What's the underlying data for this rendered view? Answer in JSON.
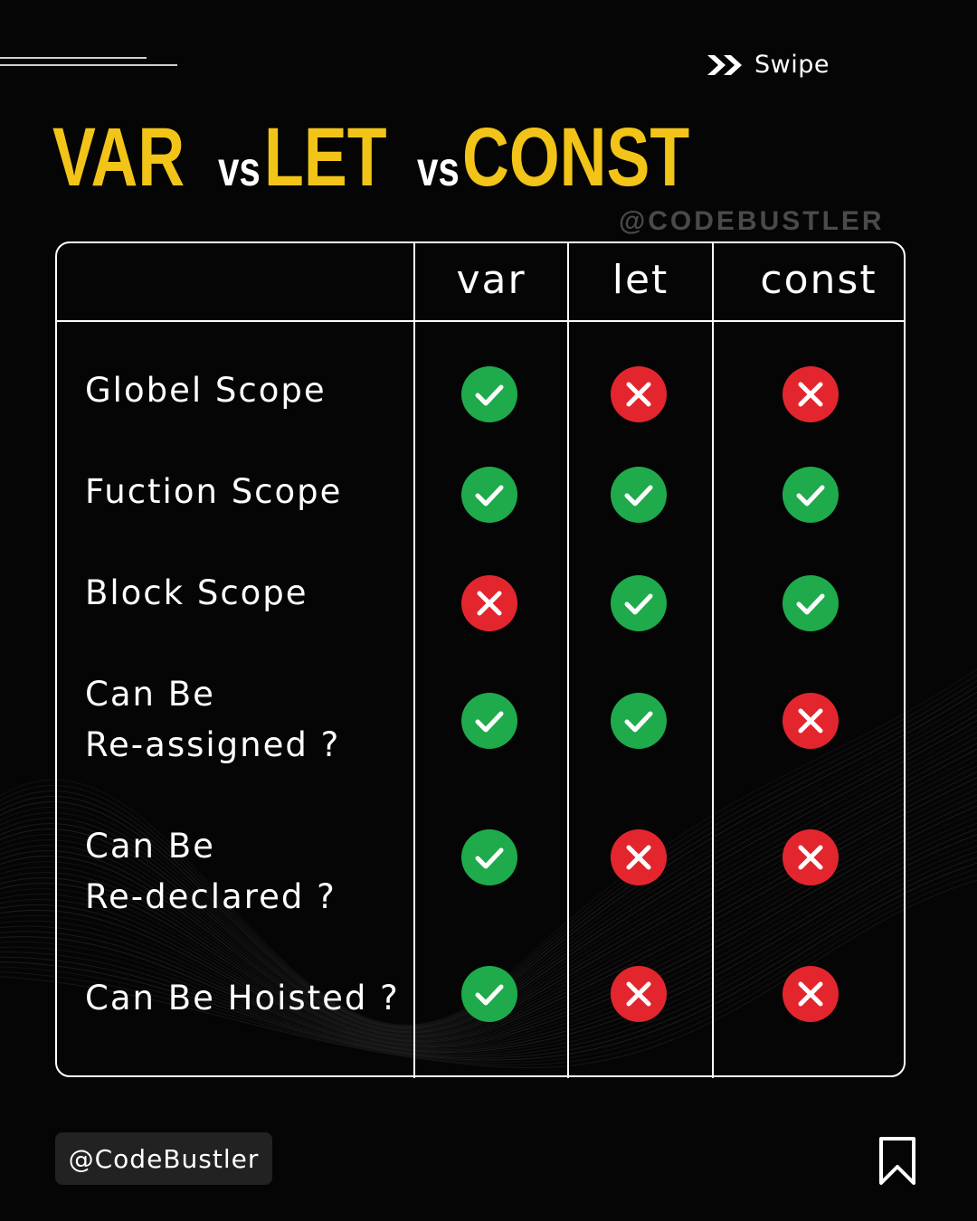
{
  "header": {
    "swipe_label": "Swipe",
    "swipe_icon": "double-chevron-right-icon"
  },
  "title": {
    "word1": "VAR",
    "sep1": "vs",
    "word2": "LET",
    "sep2": "vs",
    "word3": "CONST",
    "accent_color": "#f2c418"
  },
  "watermark": "@CODEBUSTLER",
  "table": {
    "columns": [
      "var",
      "let",
      "const"
    ],
    "rows": [
      {
        "label_lines": [
          "Globel Scope"
        ],
        "values": [
          true,
          false,
          false
        ]
      },
      {
        "label_lines": [
          "Fuction Scope"
        ],
        "values": [
          true,
          true,
          true
        ]
      },
      {
        "label_lines": [
          "Block Scope"
        ],
        "values": [
          false,
          true,
          true
        ]
      },
      {
        "label_lines": [
          "Can Be",
          "Re-assigned ?"
        ],
        "values": [
          true,
          true,
          false
        ]
      },
      {
        "label_lines": [
          "Can Be",
          "Re-declared ?"
        ],
        "values": [
          true,
          false,
          false
        ]
      },
      {
        "label_lines": [
          "Can Be Hoisted ?"
        ],
        "values": [
          true,
          false,
          false
        ]
      }
    ],
    "check_color": "#1faa4b",
    "cross_color": "#e3262e"
  },
  "footer": {
    "handle": "@CodeBustler",
    "bookmark_icon": "bookmark-icon"
  }
}
